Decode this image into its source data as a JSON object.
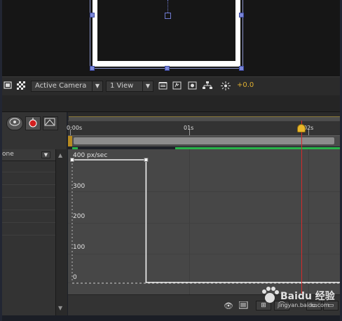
{
  "viewer_toolbar": {
    "camera_dropdown": "Active Camera",
    "view_dropdown": "1 View",
    "exposure_value": "+0.0",
    "icons": [
      "roi-icon",
      "transparency-grid-icon",
      "dropdown-arrow-icon",
      "snapshot-icon",
      "show-snapshot-icon",
      "channel-icon",
      "flowchart-icon",
      "exposure-icon"
    ]
  },
  "timeline": {
    "ruler_labels": [
      "0:00s",
      "01s",
      "02s"
    ],
    "column_header": "one",
    "tool_icons": [
      "motion-blur-icon",
      "graph-editor-icon",
      "frame-blend-icon"
    ],
    "accent_colors": {
      "current_time_indicator": "#d42b2b",
      "work_area": "#b78a20",
      "layer_bar": "#29b34a"
    }
  },
  "graph_editor": {
    "y_labels": [
      "400 px/sec",
      "300",
      "200",
      "100",
      "0"
    ],
    "bottom_icons": [
      "eye-icon",
      "graph-type-icon",
      "zoom-icon",
      "snap-icon",
      "fit-icon"
    ]
  },
  "chart_data": {
    "type": "line",
    "title": "",
    "xlabel": "",
    "ylabel": "px/sec",
    "x_unit": "seconds",
    "xlim": [
      0,
      2.5
    ],
    "ylim": [
      0,
      400
    ],
    "series": [
      {
        "x": [
          0,
          0.62,
          0.62,
          2.5
        ],
        "values": [
          400,
          400,
          0,
          0
        ]
      }
    ],
    "keyframes": [
      {
        "x": 0,
        "y": 400
      },
      {
        "x": 0.62,
        "y": 400
      }
    ],
    "grid": true
  },
  "watermark": {
    "text": "Baidu 经验",
    "sub": "jingyan.baidu.com"
  }
}
